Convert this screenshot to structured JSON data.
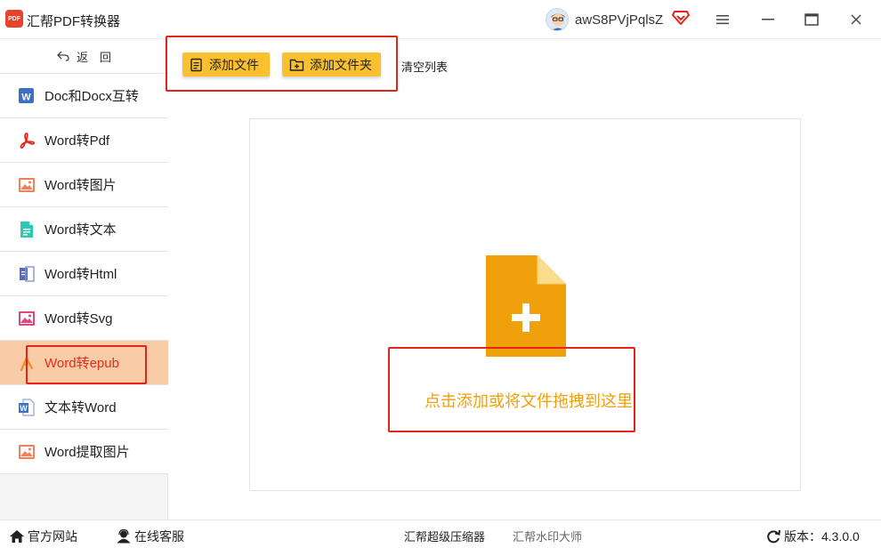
{
  "app": {
    "title": "汇帮PDF转换器",
    "logo_text": "PDF",
    "brand_color": "#e8412c",
    "accent_color": "#fbc02d"
  },
  "user": {
    "name": "awS8PVjPqlsZ"
  },
  "window_controls": [
    "menu-icon",
    "maximize-icon",
    "close-icon"
  ],
  "sidebar": {
    "back_label": "返　回",
    "items": [
      {
        "label": "Doc和Docx互转",
        "icon": "word-icon",
        "active": false
      },
      {
        "label": "Word转Pdf",
        "icon": "pdf-icon",
        "active": false
      },
      {
        "label": "Word转图片",
        "icon": "image-icon",
        "active": false
      },
      {
        "label": "Word转文本",
        "icon": "text-doc-icon",
        "active": false
      },
      {
        "label": "Word转Html",
        "icon": "html-doc-icon",
        "active": false
      },
      {
        "label": "Word转Svg",
        "icon": "svg-image-icon",
        "active": false
      },
      {
        "label": "Word转epub",
        "icon": "epub-icon",
        "active": true
      },
      {
        "label": "文本转Word",
        "icon": "word-doc-icon",
        "active": false
      },
      {
        "label": "Word提取图片",
        "icon": "extract-image-icon",
        "active": false
      }
    ]
  },
  "toolbar": {
    "add_file_label": "添加文件",
    "add_folder_label": "添加文件夹",
    "clear_list_label": "清空列表"
  },
  "dropzone": {
    "text": "点击添加或将文件拖拽到这里",
    "text_color": "#f0a00a"
  },
  "statusbar": {
    "website_label": "官方网站",
    "service_label": "在线客服",
    "compressor_label": "汇帮超级压缩器",
    "watermark_label": "汇帮水印大师",
    "version_label": "版本：4.3.0.0"
  }
}
